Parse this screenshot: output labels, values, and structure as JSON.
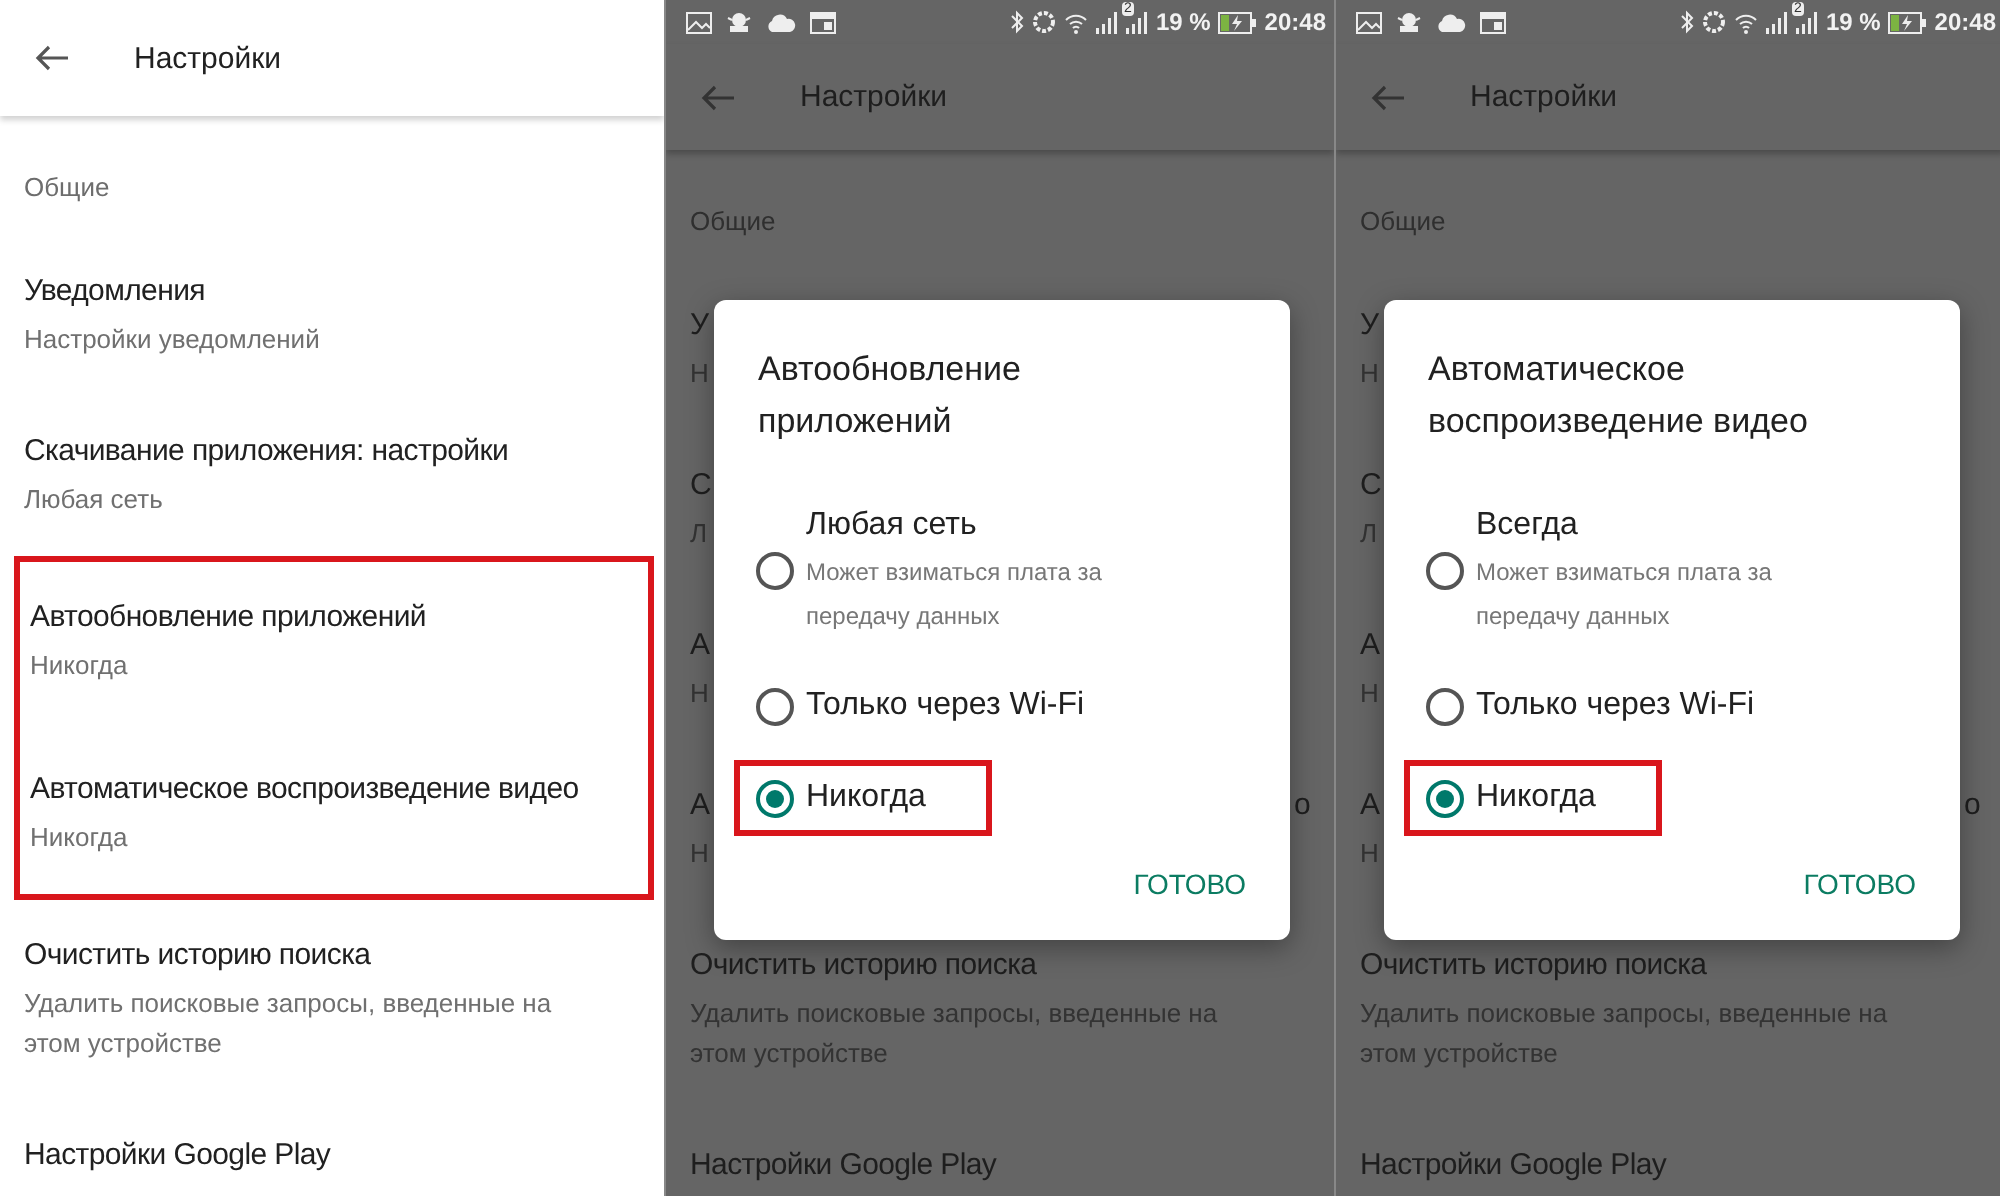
{
  "panels": [
    {
      "kind": "plain",
      "dimmed": false,
      "toolbar": {
        "title": "Настройки"
      },
      "section": "Общие",
      "items": [
        {
          "title": "Уведомления",
          "subtitle": "Настройки уведомлений",
          "highlighted": false
        },
        {
          "title": "Скачивание приложения: настройки",
          "subtitle": "Любая сеть",
          "highlighted": false
        },
        {
          "title": "Автообновление приложений",
          "subtitle": "Никогда",
          "highlighted": true
        },
        {
          "title": "Автоматическое воспроизведение видео",
          "subtitle": "Никогда",
          "highlighted": true
        },
        {
          "title": "Очистить историю поиска",
          "subtitle": "Удалить поисковые запросы, введенные на этом устройстве",
          "highlighted": false
        },
        {
          "title": "Настройки Google Play",
          "highlighted": false
        }
      ]
    },
    {
      "kind": "dialog",
      "dimmed": true,
      "status_bar": {
        "sim_badge": "2",
        "battery_percent": "19 %",
        "time": "20:48"
      },
      "toolbar": {
        "title": "Настройки"
      },
      "section": "Общие",
      "items": [
        {
          "title": "У",
          "subtitle": "Н",
          "highlighted": false
        },
        {
          "title": "С",
          "subtitle": "Л",
          "highlighted": false
        },
        {
          "title": "А",
          "subtitle": "Н",
          "highlighted": false
        },
        {
          "title": "А",
          "title_end": "о",
          "subtitle": "Н",
          "highlighted": false
        },
        {
          "title": "Очистить историю поиска",
          "subtitle": "Удалить поисковые запросы, введенные на этом устройстве",
          "highlighted": false
        },
        {
          "title": "Настройки Google Play",
          "highlighted": false
        }
      ],
      "dialog": {
        "title": "Автообновление приложений",
        "options": [
          {
            "label": "Любая сеть",
            "hint": "Может взиматься плата за передачу данных",
            "selected": false,
            "highlighted": false
          },
          {
            "label": "Только через Wi-Fi",
            "selected": false,
            "highlighted": false
          },
          {
            "label": "Никогда",
            "selected": true,
            "highlighted": true
          }
        ],
        "button": "ГОТОВО"
      }
    },
    {
      "kind": "dialog",
      "dimmed": true,
      "status_bar": {
        "sim_badge": "2",
        "battery_percent": "19 %",
        "time": "20:48"
      },
      "toolbar": {
        "title": "Настройки"
      },
      "section": "Общие",
      "items": [
        {
          "title": "У",
          "subtitle": "Н",
          "highlighted": false
        },
        {
          "title": "С",
          "subtitle": "Л",
          "highlighted": false
        },
        {
          "title": "А",
          "subtitle": "Н",
          "highlighted": false
        },
        {
          "title": "А",
          "title_end": "о",
          "subtitle": "Н",
          "highlighted": false
        },
        {
          "title": "Очистить историю поиска",
          "subtitle": "Удалить поисковые запросы, введенные на этом устройстве",
          "highlighted": false
        },
        {
          "title": "Настройки Google Play",
          "highlighted": false
        }
      ],
      "dialog": {
        "title": "Автоматическое воспроизведение видео",
        "options": [
          {
            "label": "Всегда",
            "hint": "Может взиматься плата за передачу данных",
            "selected": false,
            "highlighted": false
          },
          {
            "label": "Только через Wi-Fi",
            "selected": false,
            "highlighted": false
          },
          {
            "label": "Никогда",
            "selected": true,
            "highlighted": true
          }
        ],
        "button": "ГОТОВО"
      }
    }
  ]
}
